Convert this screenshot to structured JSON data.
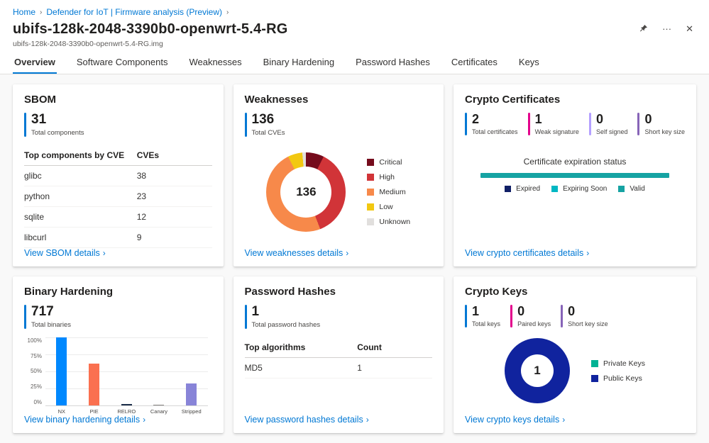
{
  "ui": {
    "breadcrumb_separator": "›",
    "chevron": "›",
    "ellipsis": "···",
    "close": "✕"
  },
  "breadcrumb": {
    "home": "Home",
    "section": "Defender for IoT | Firmware analysis (Preview)"
  },
  "header": {
    "title": "ubifs-128k-2048-3390b0-openwrt-5.4-RG",
    "subtitle": "ubifs-128k-2048-3390b0-openwrt-5.4-RG.img"
  },
  "tabs": [
    {
      "label": "Overview",
      "active": true
    },
    {
      "label": "Software Components"
    },
    {
      "label": "Weaknesses"
    },
    {
      "label": "Binary Hardening"
    },
    {
      "label": "Password Hashes"
    },
    {
      "label": "Certificates"
    },
    {
      "label": "Keys"
    }
  ],
  "cards": {
    "sbom": {
      "title": "SBOM",
      "metrics": [
        {
          "value": "31",
          "label": "Total components",
          "color": "#0078d4"
        }
      ],
      "table": {
        "headers": [
          "Top components by CVE",
          "CVEs"
        ],
        "rows": [
          {
            "name": "glibc",
            "count": "38"
          },
          {
            "name": "python",
            "count": "23"
          },
          {
            "name": "sqlite",
            "count": "12"
          },
          {
            "name": "libcurl",
            "count": "9"
          }
        ]
      },
      "link": "View SBOM details"
    },
    "weaknesses": {
      "title": "Weaknesses",
      "metrics": [
        {
          "value": "136",
          "label": "Total CVEs",
          "color": "#0078d4"
        }
      ],
      "chart": {
        "type": "donut",
        "center_label": "136",
        "segments": [
          {
            "label": "Critical",
            "value": 10,
            "color": "#750b1c"
          },
          {
            "label": "High",
            "value": 50,
            "color": "#d13438"
          },
          {
            "label": "Medium",
            "value": 66,
            "color": "#f7894a"
          },
          {
            "label": "Low",
            "value": 8,
            "color": "#f2c811"
          },
          {
            "label": "Unknown",
            "value": 2,
            "color": "#e1dfdd"
          }
        ]
      },
      "link": "View weaknesses details"
    },
    "crypto_certificates": {
      "title": "Crypto Certificates",
      "metrics": [
        {
          "value": "2",
          "label": "Total certificates",
          "color": "#0078d4"
        },
        {
          "value": "1",
          "label": "Weak signature",
          "color": "#e3008c"
        },
        {
          "value": "0",
          "label": "Self signed",
          "color": "#b4a0ff"
        },
        {
          "value": "0",
          "label": "Short key size",
          "color": "#8764b8"
        }
      ],
      "expiration": {
        "title": "Certificate expiration status",
        "type": "stacked-bar",
        "segments": [
          {
            "label": "Expired",
            "value": 0,
            "color": "#101f66"
          },
          {
            "label": "Expiring Soon",
            "value": 0,
            "color": "#00b7c3"
          },
          {
            "label": "Valid",
            "value": 2,
            "color": "#16a3a3"
          }
        ]
      },
      "link": "View crypto certificates details"
    },
    "binary_hardening": {
      "title": "Binary Hardening",
      "metrics": [
        {
          "value": "717",
          "label": "Total binaries",
          "color": "#0078d4"
        }
      ],
      "chart": {
        "type": "bar",
        "categories": [
          "NX",
          "PIE",
          "RELRO",
          "Canary",
          "Stripped"
        ],
        "values": [
          100,
          61,
          2,
          1,
          32
        ],
        "colors": [
          "#0088fe",
          "#fa7050",
          "#1c2e4a",
          "#8a8886",
          "#8884d8"
        ],
        "yticks": [
          "100%",
          "75%",
          "50%",
          "25%",
          "0%"
        ],
        "ylim": [
          0,
          100
        ]
      },
      "link": "View binary hardening details"
    },
    "password_hashes": {
      "title": "Password Hashes",
      "metrics": [
        {
          "value": "1",
          "label": "Total password hashes",
          "color": "#0078d4"
        }
      ],
      "table": {
        "headers": [
          "Top algorithms",
          "Count"
        ],
        "rows": [
          {
            "name": "MD5",
            "count": "1"
          }
        ]
      },
      "link": "View password hashes details"
    },
    "crypto_keys": {
      "title": "Crypto Keys",
      "metrics": [
        {
          "value": "1",
          "label": "Total keys",
          "color": "#0078d4"
        },
        {
          "value": "0",
          "label": "Paired keys",
          "color": "#e3008c"
        },
        {
          "value": "0",
          "label": "Short key size",
          "color": "#8764b8"
        }
      ],
      "chart": {
        "type": "donut",
        "center_label": "1",
        "segments": [
          {
            "label": "Private Keys",
            "value": 0,
            "color": "#00b294"
          },
          {
            "label": "Public Keys",
            "value": 1,
            "color": "#10239e"
          }
        ]
      },
      "link": "View crypto keys details"
    }
  }
}
